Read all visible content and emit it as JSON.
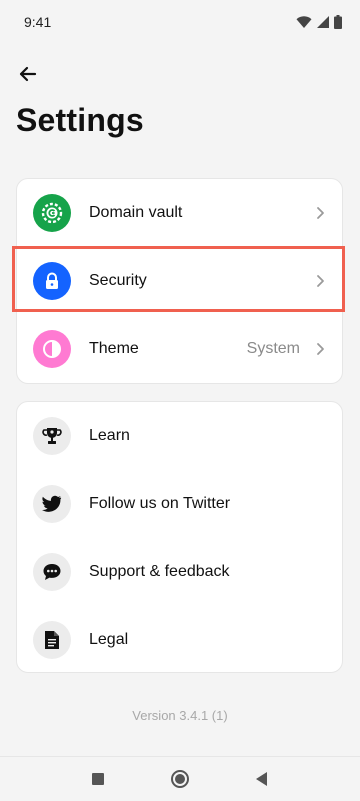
{
  "status_bar": {
    "time": "9:41",
    "icons": [
      "wifi-icon",
      "signal-icon",
      "battery-icon"
    ]
  },
  "header": {
    "back_icon": "arrow-left-icon",
    "title": "Settings"
  },
  "settings_card": {
    "items": [
      {
        "label": "Domain vault",
        "value": "",
        "icon": "domain-vault-icon",
        "icon_bg": "#16a34a"
      },
      {
        "label": "Security",
        "value": "",
        "icon": "lock-icon",
        "icon_bg": "#1463ff",
        "highlighted": true
      },
      {
        "label": "Theme",
        "value": "System",
        "icon": "theme-icon",
        "icon_bg": "#ff7ad2"
      }
    ]
  },
  "info_card": {
    "items": [
      {
        "label": "Learn",
        "icon": "trophy-icon"
      },
      {
        "label": "Follow us on Twitter",
        "icon": "twitter-icon"
      },
      {
        "label": "Support & feedback",
        "icon": "chat-icon"
      },
      {
        "label": "Legal",
        "icon": "document-icon"
      }
    ]
  },
  "footer": {
    "version": "Version 3.4.1 (1)"
  },
  "nav_bar": {
    "icons": [
      "recents-square-icon",
      "home-circle-icon",
      "back-triangle-icon"
    ]
  },
  "colors": {
    "highlight_border": "#f0604f",
    "background": "#f4f4f4",
    "card": "#ffffff"
  }
}
